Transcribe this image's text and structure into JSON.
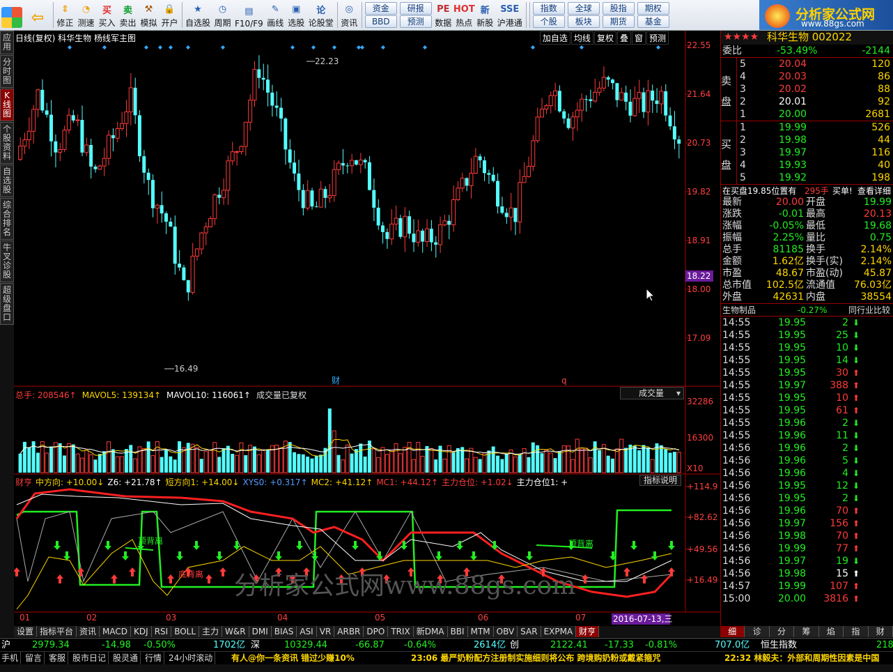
{
  "toolbar": {
    "items": [
      {
        "label": "",
        "icon": "windows-logo-icon",
        "color": "#e03030"
      },
      {
        "label": "",
        "icon": "back-arrow-icon",
        "color": "#f0a000"
      },
      {
        "label": "修正",
        "icon": "arrow-up-down-icon",
        "color": "#f0a000"
      },
      {
        "label": "测速",
        "icon": "speed-icon",
        "color": "#f0a000"
      },
      {
        "label": "买入",
        "icon": "buy-icon",
        "color": "#e03030",
        "glyph": "买"
      },
      {
        "label": "卖出",
        "icon": "sell-icon",
        "color": "#10a030",
        "glyph": "卖"
      },
      {
        "label": "模拟",
        "icon": "hammer-icon",
        "color": "#a05000"
      },
      {
        "label": "开户",
        "icon": "lock-icon",
        "color": "#888"
      },
      {
        "label": "自选股",
        "icon": "star-doc-icon",
        "color": "#2a5fb0"
      },
      {
        "label": "周期",
        "icon": "clock-icon",
        "color": "#2a5fb0"
      },
      {
        "label": "F10/F9",
        "icon": "f10-icon",
        "color": "#2a5fb0"
      },
      {
        "label": "画线",
        "icon": "pen-icon",
        "color": "#2a5fb0"
      },
      {
        "label": "选股",
        "icon": "screen-icon",
        "color": "#2a5fb0"
      },
      {
        "label": "论股堂",
        "icon": "forum-icon",
        "color": "#2a5fb0",
        "glyph": "论"
      },
      {
        "label": "资讯",
        "icon": "info-icon",
        "color": "#2a5fb0",
        "glyph": "◎"
      },
      {
        "label": "数据",
        "icon": "pe-icon",
        "color": "#c03030",
        "glyph": "PE"
      },
      {
        "label": "热点",
        "icon": "hot-icon",
        "color": "#e03030",
        "glyph": "HOT"
      },
      {
        "label": "新股",
        "icon": "new-stock-icon",
        "color": "#2a5fb0",
        "glyph": "新"
      },
      {
        "label": "沪港通",
        "icon": "hk-connect-icon",
        "color": "#2a5fb0",
        "glyph": "SSE"
      }
    ],
    "buttons_a": [
      "资金",
      "BBD"
    ],
    "buttons_b": [
      "研报",
      "预测"
    ],
    "buttons_c": [
      "指数",
      "个股"
    ],
    "buttons_d": [
      "全球",
      "板块"
    ],
    "buttons_e": [
      "股指",
      "期货"
    ],
    "buttons_f": [
      "期权",
      "基金"
    ],
    "logo_text": "分析家公式网",
    "logo_url": "www.88gs.com"
  },
  "sidebar": [
    "应用",
    "分时图",
    "K线图",
    "个股资料",
    "自选股",
    "综合排名",
    "牛叉诊股",
    "超级盘口"
  ],
  "chart": {
    "title": "日线(复权) 科华生物 杨线军主图",
    "menu": [
      "加自选",
      "均线",
      "复权",
      "叠",
      "窗",
      "预测"
    ],
    "price_axis": [
      "22.55",
      "21.64",
      "20.73",
      "19.82",
      "18.91",
      "18.00",
      "17.09"
    ],
    "current_price": "18.22",
    "high_label": "22.23",
    "low_label": "16.49",
    "finance_marks": [
      "财",
      "q"
    ],
    "vol_header": {
      "total": "总手: 208546↑",
      "ma5": "MAVOL5: 139134↑",
      "ma10": "MAVOL10: 116061↑",
      "note": "成交量已复权"
    },
    "vol_select": "成交量",
    "vol_axis": [
      "32286",
      "16300",
      "X10"
    ],
    "ind_header": [
      {
        "t": "财亨",
        "c": "#ff3b3b"
      },
      {
        "t": "中方向: +10.00↓",
        "c": "#ffd700"
      },
      {
        "t": "Z6: +21.78↑",
        "c": "#fff"
      },
      {
        "t": "短方向1: +14.00↓",
        "c": "#ffd700"
      },
      {
        "t": "XYS0: +0.317↑",
        "c": "#5599ff"
      },
      {
        "t": "MC2: +41.12↑",
        "c": "#ffd700"
      },
      {
        "t": "MC1: +44.12↑",
        "c": "#ff3b3b"
      },
      {
        "t": "主力仓位: +1.02↓",
        "c": "#ff3b3b"
      },
      {
        "t": "主力仓位1: +",
        "c": "#fff"
      }
    ],
    "ind_button": "指标说明",
    "ind_axis": [
      "+114.9",
      "+82.62",
      "+49.56",
      "+16.49"
    ],
    "ind_labels": [
      "顶背离",
      "底背离",
      "顶背离"
    ],
    "watermark": "分析家公式网www.88gs.com",
    "months": [
      "01",
      "02",
      "03",
      "04",
      "05",
      "06",
      "07"
    ],
    "cursor_date": "2016-07-13,三"
  },
  "tabs": [
    "设置",
    "指标平台",
    "资讯",
    "MACD",
    "KDJ",
    "RSI",
    "BOLL",
    "主力",
    "W&R",
    "DMI",
    "BIAS",
    "ASI",
    "VR",
    "ARBR",
    "DPO",
    "TRIX",
    "新DMA",
    "BBI",
    "MTM",
    "OBV",
    "SAR",
    "EXPMA",
    "财亨"
  ],
  "right": {
    "title": "科华生物 002022",
    "weibi": {
      "label": "委比",
      "pct": "-53.49%",
      "diff": "-2144"
    },
    "sell": [
      [
        "5",
        "20.04",
        "120"
      ],
      [
        "4",
        "20.03",
        "86"
      ],
      [
        "3",
        "20.02",
        "88"
      ],
      [
        "2",
        "20.01",
        "92"
      ],
      [
        "1",
        "20.00",
        "2681"
      ]
    ],
    "buy": [
      [
        "1",
        "19.99",
        "526"
      ],
      [
        "2",
        "19.98",
        "44"
      ],
      [
        "3",
        "19.97",
        "116"
      ],
      [
        "4",
        "19.93",
        "40"
      ],
      [
        "5",
        "19.92",
        "198"
      ]
    ],
    "sell_label": "卖盘",
    "buy_label": "买盘",
    "notice": {
      "a": "在买盘19.85位置有",
      "b": "295手",
      "c": "买单!",
      "d": "查看详细"
    },
    "quote": [
      [
        "最新",
        "20.00",
        "开盘",
        "19.99"
      ],
      [
        "涨跌",
        "-0.01",
        "最高",
        "20.13"
      ],
      [
        "涨幅",
        "-0.05%",
        "最低",
        "19.68"
      ],
      [
        "振幅",
        "2.25%",
        "量比",
        "0.75"
      ],
      [
        "总手",
        "81185",
        "换手",
        "2.14%"
      ],
      [
        "金额",
        "1.62亿",
        "换手(实)",
        "2.14%"
      ],
      [
        "市盈",
        "48.67",
        "市盈(动)",
        "45.87"
      ],
      [
        "总市值",
        "102.5亿",
        "流通值",
        "76.03亿"
      ],
      [
        "外盘",
        "42631",
        "内盘",
        "38554"
      ]
    ],
    "industry": {
      "name": "生物制品",
      "pct": "-0.27%",
      "btn": "同行业比较"
    },
    "ticks": [
      [
        "14:55",
        "19.95",
        "2",
        "d"
      ],
      [
        "14:55",
        "19.95",
        "25",
        "d"
      ],
      [
        "14:55",
        "19.95",
        "10",
        "d"
      ],
      [
        "14:55",
        "19.95",
        "14",
        "d"
      ],
      [
        "14:55",
        "19.95",
        "30",
        "u"
      ],
      [
        "14:55",
        "19.97",
        "388",
        "u"
      ],
      [
        "14:55",
        "19.95",
        "10",
        "u"
      ],
      [
        "14:55",
        "19.95",
        "61",
        "u"
      ],
      [
        "14:55",
        "19.96",
        "2",
        "d"
      ],
      [
        "14:55",
        "19.96",
        "11",
        "d"
      ],
      [
        "14:56",
        "19.96",
        "2",
        "d"
      ],
      [
        "14:56",
        "19.96",
        "5",
        "d"
      ],
      [
        "14:56",
        "19.96",
        "4",
        "d"
      ],
      [
        "14:56",
        "19.95",
        "12",
        "d"
      ],
      [
        "14:56",
        "19.95",
        "2",
        "d"
      ],
      [
        "14:56",
        "19.96",
        "70",
        "u"
      ],
      [
        "14:56",
        "19.97",
        "156",
        "u"
      ],
      [
        "14:56",
        "19.98",
        "70",
        "u"
      ],
      [
        "14:56",
        "19.99",
        "77",
        "u"
      ],
      [
        "14:56",
        "19.97",
        "19",
        "d"
      ],
      [
        "14:56",
        "19.98",
        "15",
        "w"
      ],
      [
        "14:57",
        "19.99",
        "107",
        "u"
      ],
      [
        "15:00",
        "20.00",
        "3816",
        "u"
      ]
    ]
  },
  "rtabs": [
    "细",
    "诊",
    "分",
    "筹",
    "焰",
    "指",
    "财"
  ],
  "status1": {
    "sh": "沪",
    "sh_idx": "2979.34",
    "sh_chg": "-14.98",
    "sh_pct": "-0.50%",
    "sh_amt": "1702亿",
    "sz": "深",
    "sz_idx": "10329.44",
    "sz_chg": "-66.87",
    "sz_pct": "-0.64%",
    "sz_amt": "2614亿",
    "cy": "创",
    "cy_idx": "2122.41",
    "cy_chg": "-17.33",
    "cy_pct": "-0.81%",
    "cy_amt": "707.0亿",
    "hs": "恒生指数",
    "hs_idx": "218"
  },
  "status2": {
    "items": [
      "手机",
      "留言",
      "客服",
      "股市日记",
      "股灵通",
      "行情",
      "24小时滚动"
    ],
    "news1": "有人@你一条资讯 错过少赚10%",
    "news2": "23:06 最严奶粉配方注册制实施细则将公布 跨境购奶粉或戴紧箍咒",
    "news3": "22:32 林毅夫：外部和周期性因素是中国"
  }
}
